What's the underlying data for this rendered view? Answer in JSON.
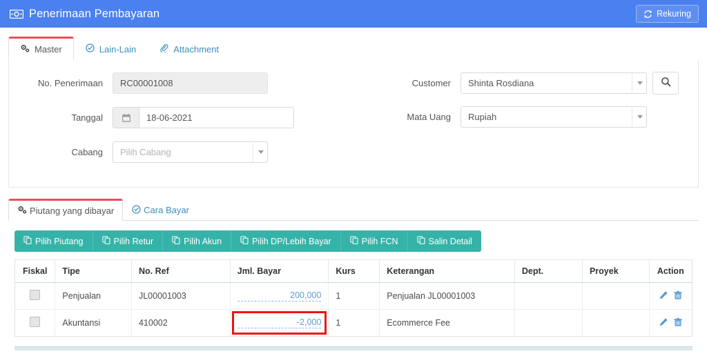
{
  "titlebar": {
    "icon": "money-bill-icon",
    "title": "Penerimaan Pembayaran",
    "recurring_button": {
      "label": "Rekuring",
      "icon": "refresh-icon"
    },
    "bg_color": "#4a80f0"
  },
  "top_tabs": [
    {
      "label": "Master",
      "icon": "gears-icon",
      "active": true
    },
    {
      "label": "Lain-Lain",
      "icon": "check-circle-icon",
      "active": false
    },
    {
      "label": "Attachment",
      "icon": "paperclip-icon",
      "active": false
    }
  ],
  "master_form": {
    "no_penerimaan": {
      "label": "No. Penerimaan",
      "value": "RC00001008",
      "readonly": true
    },
    "tanggal": {
      "label": "Tanggal",
      "value": "18-06-2021",
      "icon": "calendar-icon"
    },
    "cabang": {
      "label": "Cabang",
      "value": "",
      "placeholder": "Pilih Cabang"
    },
    "customer": {
      "label": "Customer",
      "value": "Shinta Rosdiana",
      "search_icon": "search-icon"
    },
    "mata_uang": {
      "label": "Mata Uang",
      "value": "Rupiah"
    }
  },
  "lower_tabs": [
    {
      "label": "Piutang yang dibayar",
      "icon": "gears-icon",
      "active": true
    },
    {
      "label": "Cara Bayar",
      "icon": "check-circle-icon",
      "active": false
    }
  ],
  "toolbar": {
    "accent_color": "#36b3a8",
    "buttons": [
      {
        "label": "Pilih Piutang",
        "icon": "copy-icon"
      },
      {
        "label": "Pilih Retur",
        "icon": "copy-icon"
      },
      {
        "label": "Pilih Akun",
        "icon": "copy-icon"
      },
      {
        "label": "Pilih DP/Lebih Bayar",
        "icon": "copy-icon"
      },
      {
        "label": "Pilih FCN",
        "icon": "copy-icon"
      },
      {
        "label": "Salin Detail",
        "icon": "copy-icon"
      }
    ]
  },
  "table": {
    "columns": [
      "Fiskal",
      "Tipe",
      "No. Ref",
      "Jml. Bayar",
      "Kurs",
      "Keterangan",
      "Dept.",
      "Proyek",
      "Action"
    ],
    "rows": [
      {
        "fiskal": "",
        "tipe": "Penjualan",
        "no_ref": "JL00001003",
        "jml_bayar": "200,000",
        "kurs": "1",
        "keterangan": "Penjualan JL00001003",
        "dept": "",
        "proyek": "",
        "highlighted": false,
        "actions": [
          "edit-icon",
          "delete-icon"
        ]
      },
      {
        "fiskal": "",
        "tipe": "Akuntansi",
        "no_ref": "410002",
        "jml_bayar": "-2,000",
        "kurs": "1",
        "keterangan": "Ecommerce Fee",
        "dept": "",
        "proyek": "",
        "highlighted": true,
        "highlight_color": "#ee1111",
        "actions": [
          "edit-icon",
          "delete-icon"
        ]
      }
    ]
  }
}
